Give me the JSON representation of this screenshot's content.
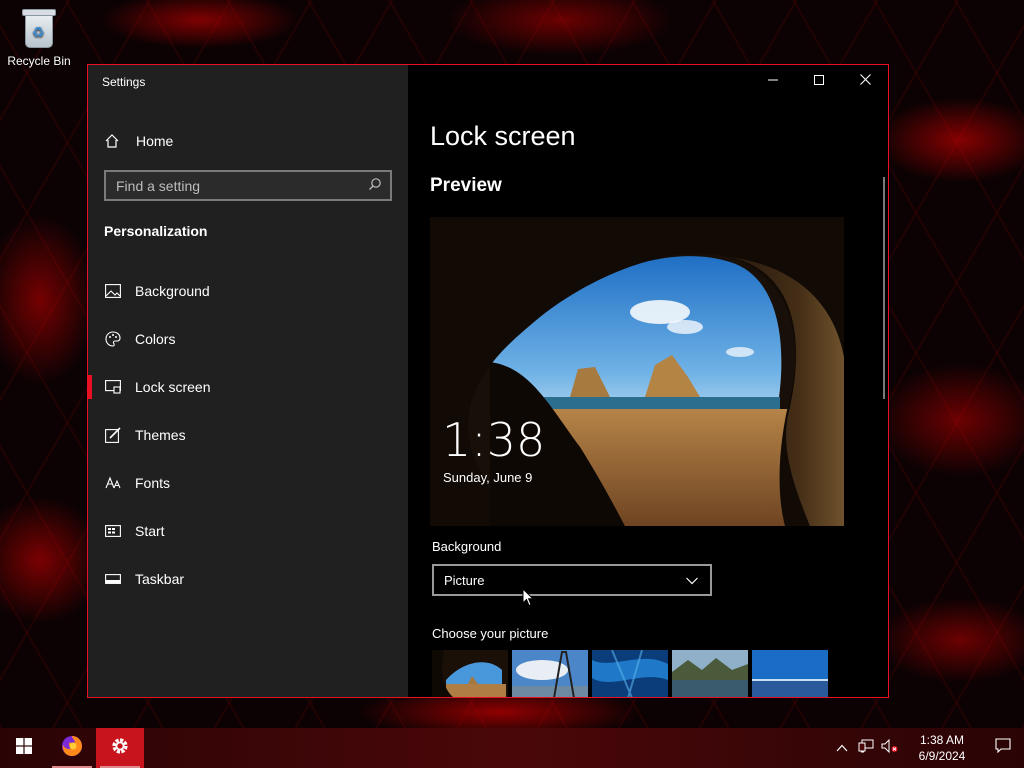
{
  "desktop": {
    "icons": [
      {
        "label": "Recycle Bin",
        "icon": "recycle-bin-icon"
      }
    ]
  },
  "window": {
    "title": "Settings",
    "accent_color": "#e81123",
    "controls": {
      "minimize": "minimize-icon",
      "maximize": "maximize-icon",
      "close": "close-icon"
    }
  },
  "sidebar": {
    "home_label": "Home",
    "search": {
      "placeholder": "Find a setting",
      "value": ""
    },
    "section_title": "Personalization",
    "items": [
      {
        "label": "Background",
        "icon": "picture-icon",
        "active": false
      },
      {
        "label": "Colors",
        "icon": "palette-icon",
        "active": false
      },
      {
        "label": "Lock screen",
        "icon": "lock-screen-icon",
        "active": true
      },
      {
        "label": "Themes",
        "icon": "brush-icon",
        "active": false
      },
      {
        "label": "Fonts",
        "icon": "font-icon",
        "active": false
      },
      {
        "label": "Start",
        "icon": "start-icon",
        "active": false
      },
      {
        "label": "Taskbar",
        "icon": "taskbar-icon",
        "active": false
      }
    ]
  },
  "main": {
    "title": "Lock screen",
    "preview_heading": "Preview",
    "preview": {
      "time": "1:38",
      "date": "Sunday, June 9"
    },
    "background_label": "Background",
    "background_value": "Picture",
    "choose_label": "Choose your picture"
  },
  "taskbar": {
    "apps": [
      "start-icon",
      "firefox-icon",
      "settings-icon"
    ],
    "clock": {
      "time": "1:38 AM",
      "date": "6/9/2024"
    }
  }
}
